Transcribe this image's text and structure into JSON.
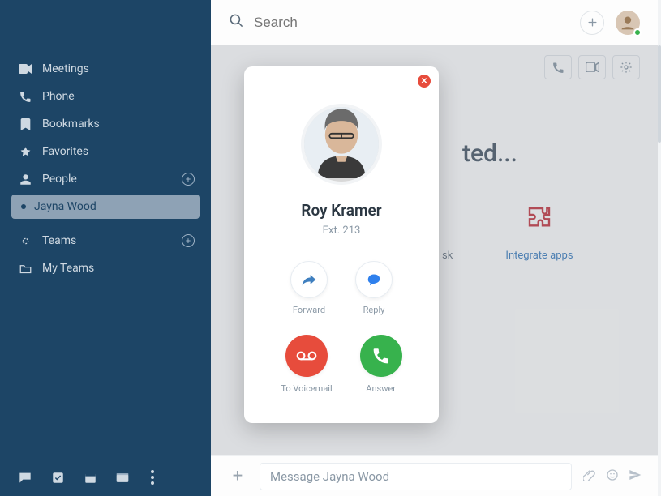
{
  "sidebar": {
    "items": [
      {
        "label": "Meetings",
        "icon": "video"
      },
      {
        "label": "Phone",
        "icon": "phone"
      },
      {
        "label": "Bookmarks",
        "icon": "bookmark"
      },
      {
        "label": "Favorites",
        "icon": "star"
      },
      {
        "label": "People",
        "icon": "person",
        "hasAdd": true
      }
    ],
    "selected_person": "Jayna Wood",
    "groups": [
      {
        "label": "Teams",
        "icon": "gear-ring",
        "hasAdd": true
      },
      {
        "label": "My Teams",
        "icon": "folder"
      }
    ]
  },
  "topbar": {
    "search_placeholder": "Search"
  },
  "header_actions": {
    "call": "phone-icon",
    "video": "video-icon",
    "settings": "gear-icon"
  },
  "hero": {
    "text_fragment": "ted..."
  },
  "shortcut": {
    "left_label": "sk",
    "label": "Integrate apps",
    "icon": "puzzle-icon",
    "accent": "#c53a45"
  },
  "composer": {
    "placeholder": "Message Jayna Wood"
  },
  "call": {
    "name": "Roy Kramer",
    "ext": "Ext. 213",
    "actions_top": [
      {
        "label": "Forward",
        "icon": "forward",
        "color": "#3f7fbf"
      },
      {
        "label": "Reply",
        "icon": "reply",
        "color": "#2f80ed"
      }
    ],
    "actions_bottom": [
      {
        "label": "To Voicemail",
        "icon": "voicemail",
        "bg": "red"
      },
      {
        "label": "Answer",
        "icon": "answer",
        "bg": "green"
      }
    ]
  },
  "colors": {
    "sidebar_bg": "#1d4566",
    "red": "#e74c3c",
    "green": "#37b24d",
    "blue": "#2f80ed"
  }
}
